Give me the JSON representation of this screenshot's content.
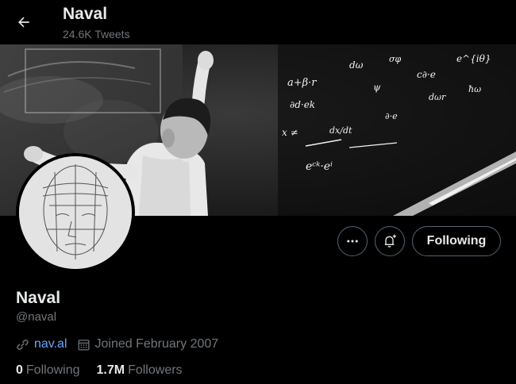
{
  "header": {
    "title": "Naval",
    "subtitle": "24.6K Tweets"
  },
  "banner": {
    "equations": [
      "a+β·r",
      "dω",
      "σφ",
      "c∂·e",
      "e^{iθ}",
      "∂d·ek",
      "ψ",
      "eᶜᵏ·eⁱ",
      "∂·e",
      "x ≠",
      "ħω",
      "dx/dt",
      "dωr"
    ]
  },
  "profile": {
    "name": "Naval",
    "handle": "@naval",
    "website": "nav.al",
    "joined": "Joined February 2007"
  },
  "actions": {
    "following_label": "Following"
  },
  "stats": {
    "following_count": "0",
    "following_label": "Following",
    "followers_count": "1.7M",
    "followers_label": "Followers"
  },
  "colors": {
    "background": "#000000",
    "text_primary": "#e7e9ea",
    "text_secondary": "#71767b",
    "link": "#6aa6f8",
    "button_border": "#536471"
  },
  "icons": {
    "back": "arrow-left-icon",
    "more": "ellipsis-icon",
    "notify": "bell-plus-icon",
    "website": "link-icon",
    "joined": "calendar-icon"
  }
}
